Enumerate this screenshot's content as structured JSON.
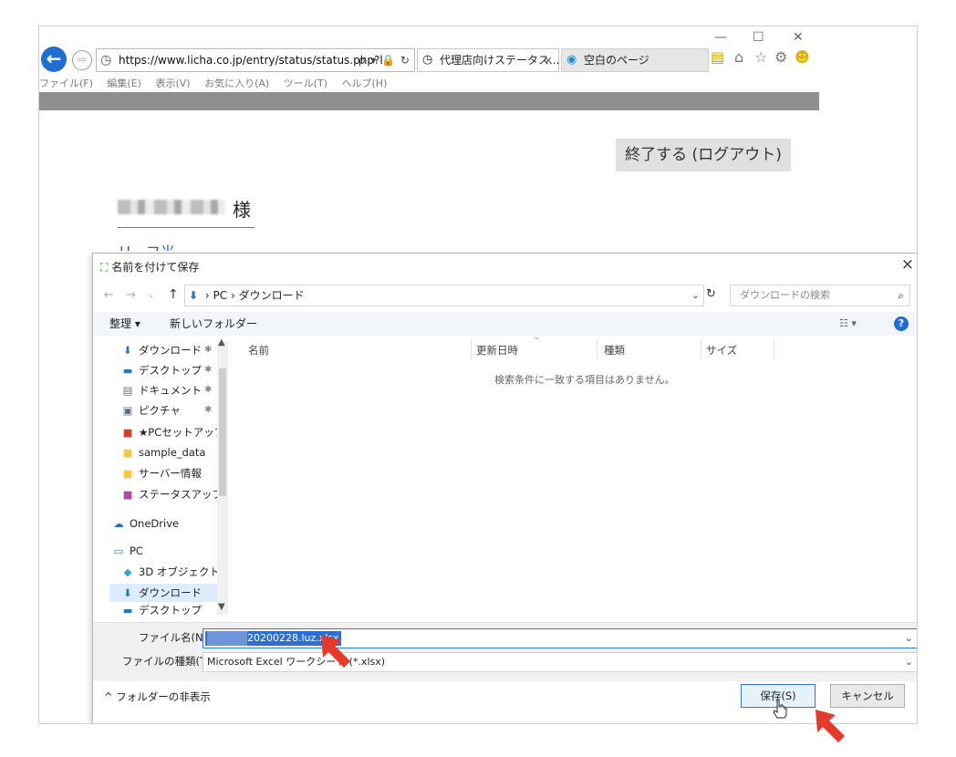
{
  "browser": {
    "window_controls": {
      "minimize": "—",
      "maximize": "☐",
      "close": "✕"
    },
    "back_label": "←",
    "forward_label": "⇨",
    "address": {
      "url": "https://www.licha.co.jp/entry/status/status.php?l",
      "tail_icons": "ρ ▾ 🔒 ↻"
    },
    "tabs": [
      {
        "label": "代理店向けステータス...",
        "close": "×",
        "icon": "site-icon"
      },
      {
        "label": "空白のページ",
        "icon": "ie-icon"
      }
    ],
    "toolbar_icons": [
      "favorites-add-icon",
      "home-icon",
      "star-icon",
      "gear-icon",
      "smiley-icon"
    ],
    "menu": [
      "ファイル(F)",
      "編集(E)",
      "表示(V)",
      "お気に入り(A)",
      "ツール(T)",
      "ヘルプ(H)"
    ]
  },
  "page": {
    "logout_label": "終了する (ログアウト)",
    "honorific": "様",
    "partial_link": "リーフ光"
  },
  "dialog": {
    "title": "名前を付けて保存",
    "close": "×",
    "path": {
      "root": "PC",
      "separator": "›",
      "folder": "ダウンロード"
    },
    "search_placeholder": "ダウンロードの検索",
    "toolbar": {
      "organize": "整理 ▾",
      "new_folder": "新しいフォルダー",
      "view": "☷ ▾",
      "help": "?"
    },
    "nav_items": [
      {
        "label": "ダウンロード",
        "icon": "download-icon",
        "pinned": true
      },
      {
        "label": "デスクトップ",
        "icon": "desktop-icon",
        "pinned": true
      },
      {
        "label": "ドキュメント",
        "icon": "document-icon",
        "pinned": true
      },
      {
        "label": "ピクチャ",
        "icon": "picture-icon",
        "pinned": true
      },
      {
        "label": "★PCセットアップ",
        "icon": "folder-red-icon",
        "pinned": false
      },
      {
        "label": "sample_data",
        "icon": "folder-icon",
        "pinned": false
      },
      {
        "label": "サーバー情報",
        "icon": "folder-icon",
        "pinned": false
      },
      {
        "label": "ステータスアップロー",
        "icon": "folder-purple-icon",
        "pinned": false
      },
      {
        "label": "OneDrive",
        "icon": "cloud-icon",
        "pinned": false
      },
      {
        "label": "PC",
        "icon": "pc-icon",
        "pinned": false
      },
      {
        "label": "3D オブジェクト",
        "icon": "cube-icon",
        "pinned": false
      },
      {
        "label": "ダウンロード",
        "icon": "download-icon",
        "pinned": false,
        "selected": true
      },
      {
        "label": "デスクトップ",
        "icon": "desktop-icon",
        "pinned": false
      }
    ],
    "columns": [
      "名前",
      "更新日時",
      "種類",
      "サイズ"
    ],
    "empty_message": "検索条件に一致する項目はありません。",
    "filename_label": "ファイル名(N):",
    "filename_value": "20200228.luz.xlsx",
    "filetype_label": "ファイルの種類(T):",
    "filetype_value": "Microsoft Excel ワークシート (*.xlsx)",
    "hide_folders": "フォルダーの非表示",
    "save_label": "保存(S)",
    "cancel_label": "キャンセル"
  },
  "colors": {
    "accent": "#1f6fd1",
    "highlight": "#e53a2a",
    "selection": "#2f6fd1"
  }
}
